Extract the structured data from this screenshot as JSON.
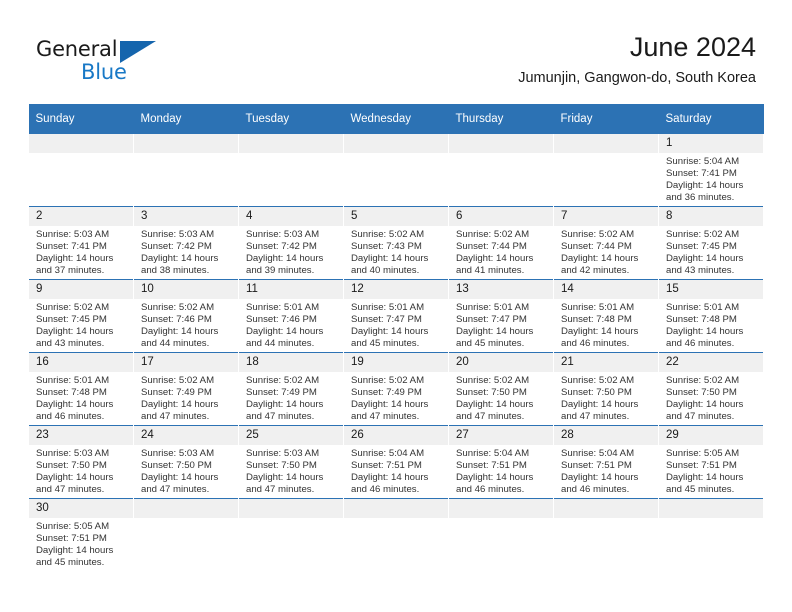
{
  "brand": {
    "name_part1": "General",
    "name_part2": "Blue",
    "triangle_icon": "triangle-logo-mark",
    "color_dark": "#1a1a1a",
    "color_blue": "#1878c6"
  },
  "header": {
    "month_title": "June 2024",
    "location": "Jumunjin, Gangwon-do, South Korea"
  },
  "theme": {
    "header_blue": "#2c72b4",
    "daynum_background": "#f0f0f0",
    "row_divider": "#2c72b4"
  },
  "calendar": {
    "weekday_headers": [
      "Sunday",
      "Monday",
      "Tuesday",
      "Wednesday",
      "Thursday",
      "Friday",
      "Saturday"
    ],
    "weeks": [
      [
        {
          "day": "",
          "empty": true,
          "lines": []
        },
        {
          "day": "",
          "empty": true,
          "lines": []
        },
        {
          "day": "",
          "empty": true,
          "lines": []
        },
        {
          "day": "",
          "empty": true,
          "lines": []
        },
        {
          "day": "",
          "empty": true,
          "lines": []
        },
        {
          "day": "",
          "empty": true,
          "lines": []
        },
        {
          "day": "1",
          "empty": false,
          "lines": [
            "Sunrise: 5:04 AM",
            "Sunset: 7:41 PM",
            "Daylight: 14 hours",
            "and 36 minutes."
          ]
        }
      ],
      [
        {
          "day": "2",
          "empty": false,
          "lines": [
            "Sunrise: 5:03 AM",
            "Sunset: 7:41 PM",
            "Daylight: 14 hours",
            "and 37 minutes."
          ]
        },
        {
          "day": "3",
          "empty": false,
          "lines": [
            "Sunrise: 5:03 AM",
            "Sunset: 7:42 PM",
            "Daylight: 14 hours",
            "and 38 minutes."
          ]
        },
        {
          "day": "4",
          "empty": false,
          "lines": [
            "Sunrise: 5:03 AM",
            "Sunset: 7:42 PM",
            "Daylight: 14 hours",
            "and 39 minutes."
          ]
        },
        {
          "day": "5",
          "empty": false,
          "lines": [
            "Sunrise: 5:02 AM",
            "Sunset: 7:43 PM",
            "Daylight: 14 hours",
            "and 40 minutes."
          ]
        },
        {
          "day": "6",
          "empty": false,
          "lines": [
            "Sunrise: 5:02 AM",
            "Sunset: 7:44 PM",
            "Daylight: 14 hours",
            "and 41 minutes."
          ]
        },
        {
          "day": "7",
          "empty": false,
          "lines": [
            "Sunrise: 5:02 AM",
            "Sunset: 7:44 PM",
            "Daylight: 14 hours",
            "and 42 minutes."
          ]
        },
        {
          "day": "8",
          "empty": false,
          "lines": [
            "Sunrise: 5:02 AM",
            "Sunset: 7:45 PM",
            "Daylight: 14 hours",
            "and 43 minutes."
          ]
        }
      ],
      [
        {
          "day": "9",
          "empty": false,
          "lines": [
            "Sunrise: 5:02 AM",
            "Sunset: 7:45 PM",
            "Daylight: 14 hours",
            "and 43 minutes."
          ]
        },
        {
          "day": "10",
          "empty": false,
          "lines": [
            "Sunrise: 5:02 AM",
            "Sunset: 7:46 PM",
            "Daylight: 14 hours",
            "and 44 minutes."
          ]
        },
        {
          "day": "11",
          "empty": false,
          "lines": [
            "Sunrise: 5:01 AM",
            "Sunset: 7:46 PM",
            "Daylight: 14 hours",
            "and 44 minutes."
          ]
        },
        {
          "day": "12",
          "empty": false,
          "lines": [
            "Sunrise: 5:01 AM",
            "Sunset: 7:47 PM",
            "Daylight: 14 hours",
            "and 45 minutes."
          ]
        },
        {
          "day": "13",
          "empty": false,
          "lines": [
            "Sunrise: 5:01 AM",
            "Sunset: 7:47 PM",
            "Daylight: 14 hours",
            "and 45 minutes."
          ]
        },
        {
          "day": "14",
          "empty": false,
          "lines": [
            "Sunrise: 5:01 AM",
            "Sunset: 7:48 PM",
            "Daylight: 14 hours",
            "and 46 minutes."
          ]
        },
        {
          "day": "15",
          "empty": false,
          "lines": [
            "Sunrise: 5:01 AM",
            "Sunset: 7:48 PM",
            "Daylight: 14 hours",
            "and 46 minutes."
          ]
        }
      ],
      [
        {
          "day": "16",
          "empty": false,
          "lines": [
            "Sunrise: 5:01 AM",
            "Sunset: 7:48 PM",
            "Daylight: 14 hours",
            "and 46 minutes."
          ]
        },
        {
          "day": "17",
          "empty": false,
          "lines": [
            "Sunrise: 5:02 AM",
            "Sunset: 7:49 PM",
            "Daylight: 14 hours",
            "and 47 minutes."
          ]
        },
        {
          "day": "18",
          "empty": false,
          "lines": [
            "Sunrise: 5:02 AM",
            "Sunset: 7:49 PM",
            "Daylight: 14 hours",
            "and 47 minutes."
          ]
        },
        {
          "day": "19",
          "empty": false,
          "lines": [
            "Sunrise: 5:02 AM",
            "Sunset: 7:49 PM",
            "Daylight: 14 hours",
            "and 47 minutes."
          ]
        },
        {
          "day": "20",
          "empty": false,
          "lines": [
            "Sunrise: 5:02 AM",
            "Sunset: 7:50 PM",
            "Daylight: 14 hours",
            "and 47 minutes."
          ]
        },
        {
          "day": "21",
          "empty": false,
          "lines": [
            "Sunrise: 5:02 AM",
            "Sunset: 7:50 PM",
            "Daylight: 14 hours",
            "and 47 minutes."
          ]
        },
        {
          "day": "22",
          "empty": false,
          "lines": [
            "Sunrise: 5:02 AM",
            "Sunset: 7:50 PM",
            "Daylight: 14 hours",
            "and 47 minutes."
          ]
        }
      ],
      [
        {
          "day": "23",
          "empty": false,
          "lines": [
            "Sunrise: 5:03 AM",
            "Sunset: 7:50 PM",
            "Daylight: 14 hours",
            "and 47 minutes."
          ]
        },
        {
          "day": "24",
          "empty": false,
          "lines": [
            "Sunrise: 5:03 AM",
            "Sunset: 7:50 PM",
            "Daylight: 14 hours",
            "and 47 minutes."
          ]
        },
        {
          "day": "25",
          "empty": false,
          "lines": [
            "Sunrise: 5:03 AM",
            "Sunset: 7:50 PM",
            "Daylight: 14 hours",
            "and 47 minutes."
          ]
        },
        {
          "day": "26",
          "empty": false,
          "lines": [
            "Sunrise: 5:04 AM",
            "Sunset: 7:51 PM",
            "Daylight: 14 hours",
            "and 46 minutes."
          ]
        },
        {
          "day": "27",
          "empty": false,
          "lines": [
            "Sunrise: 5:04 AM",
            "Sunset: 7:51 PM",
            "Daylight: 14 hours",
            "and 46 minutes."
          ]
        },
        {
          "day": "28",
          "empty": false,
          "lines": [
            "Sunrise: 5:04 AM",
            "Sunset: 7:51 PM",
            "Daylight: 14 hours",
            "and 46 minutes."
          ]
        },
        {
          "day": "29",
          "empty": false,
          "lines": [
            "Sunrise: 5:05 AM",
            "Sunset: 7:51 PM",
            "Daylight: 14 hours",
            "and 45 minutes."
          ]
        }
      ],
      [
        {
          "day": "30",
          "empty": false,
          "lines": [
            "Sunrise: 5:05 AM",
            "Sunset: 7:51 PM",
            "Daylight: 14 hours",
            "and 45 minutes."
          ]
        },
        {
          "day": "",
          "empty": true,
          "lines": []
        },
        {
          "day": "",
          "empty": true,
          "lines": []
        },
        {
          "day": "",
          "empty": true,
          "lines": []
        },
        {
          "day": "",
          "empty": true,
          "lines": []
        },
        {
          "day": "",
          "empty": true,
          "lines": []
        },
        {
          "day": "",
          "empty": true,
          "lines": []
        }
      ]
    ]
  }
}
